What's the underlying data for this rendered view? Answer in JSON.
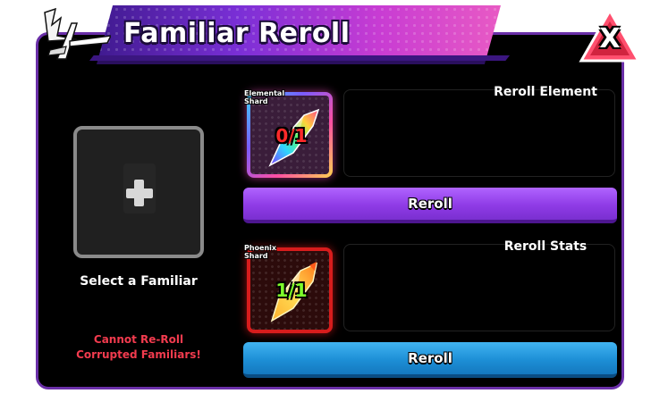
{
  "header": {
    "title": "Familiar Reroll",
    "close_label": "X"
  },
  "familiar_selector": {
    "label": "Select a Familiar",
    "warning": "Cannot Re-Roll Corrupted Familiars!"
  },
  "element_reroll": {
    "shard_name_line1": "Elemental",
    "shard_name_line2": "Shard",
    "shard_count": "0/1",
    "title": "Reroll Element",
    "button_label": "Reroll",
    "count_color": "#ff2a2a"
  },
  "stats_reroll": {
    "shard_name_line1": "Phoenix",
    "shard_name_line2": "Shard",
    "shard_count": "1/1",
    "title": "Reroll Stats",
    "button_label": "Reroll",
    "count_color": "#7dff2a"
  },
  "icons": {
    "emblem": "winged-emblem-icon",
    "close": "close-icon",
    "add": "plus-icon",
    "elemental_shard": "elemental-shard-icon",
    "phoenix_shard": "phoenix-shard-icon"
  }
}
